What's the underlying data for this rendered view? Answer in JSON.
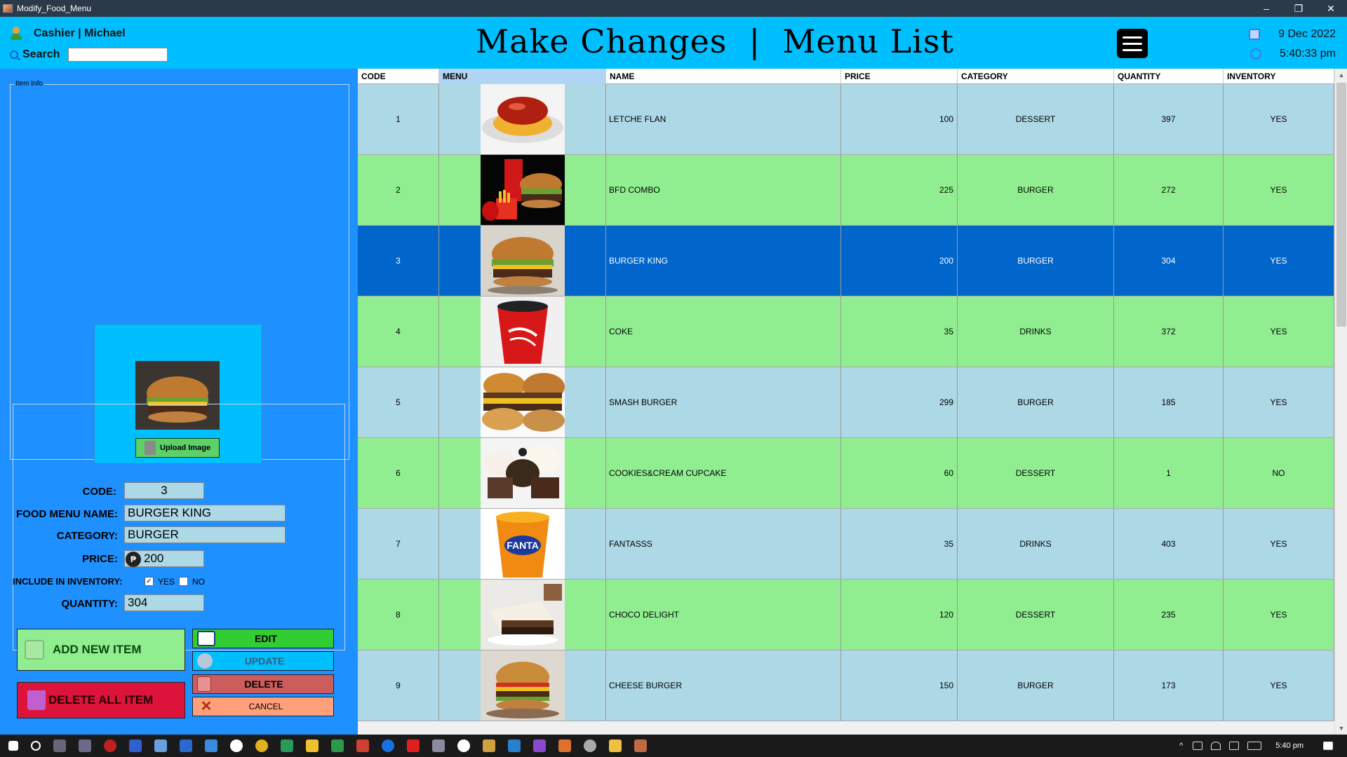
{
  "window": {
    "title": "Modify_Food_Menu",
    "controls": [
      "–",
      "❐",
      "✕"
    ]
  },
  "header": {
    "user": "Cashier | Michael",
    "search_label": "Search",
    "search_value": "",
    "title": "Make Changes  |  Menu List",
    "date": "9 Dec 2022",
    "time": "5:40:33 pm"
  },
  "item_info": {
    "group_label": "Item Info",
    "upload_label": "Upload Image",
    "labels": {
      "code": "CODE:",
      "name": "FOOD MENU NAME:",
      "category": "CATEGORY:",
      "price": "PRICE:",
      "inventory": "INCLUDE IN INVENTORY:",
      "quantity": "QUANTITY:",
      "yes": "YES",
      "no": "NO",
      "peso": "₱"
    },
    "values": {
      "code": "3",
      "name": "BURGER KING",
      "category": "BURGER",
      "price": "200",
      "quantity": "304",
      "inventory_yes_checked": true,
      "inventory_no_checked": false
    }
  },
  "buttons": {
    "add": "ADD NEW ITEM",
    "delete_all": "DELETE ALL ITEM",
    "edit": "EDIT",
    "update": "UPDATE",
    "delete": "DELETE",
    "cancel": "CANCEL"
  },
  "table": {
    "columns": [
      "CODE",
      "MENU",
      "NAME",
      "PRICE",
      "CATEGORY",
      "QUANTITY",
      "INVENTORY"
    ],
    "selected_code": "3",
    "rows": [
      {
        "code": "1",
        "name": "LETCHE FLAN",
        "price": "100",
        "category": "DESSERT",
        "quantity": "397",
        "inventory": "YES",
        "image": "flan-image"
      },
      {
        "code": "2",
        "name": "BFD COMBO",
        "price": "225",
        "category": "BURGER",
        "quantity": "272",
        "inventory": "YES",
        "image": "combo-image"
      },
      {
        "code": "3",
        "name": "BURGER KING",
        "price": "200",
        "category": "BURGER",
        "quantity": "304",
        "inventory": "YES",
        "image": "burger-image"
      },
      {
        "code": "4",
        "name": "COKE",
        "price": "35",
        "category": "DRINKS",
        "quantity": "372",
        "inventory": "YES",
        "image": "coke-image"
      },
      {
        "code": "5",
        "name": "SMASH BURGER",
        "price": "299",
        "category": "BURGER",
        "quantity": "185",
        "inventory": "YES",
        "image": "smash-burger-image"
      },
      {
        "code": "6",
        "name": "COOKIES&CREAM CUPCAKE",
        "price": "60",
        "category": "DESSERT",
        "quantity": "1",
        "inventory": "NO",
        "image": "cupcake-image"
      },
      {
        "code": "7",
        "name": "FANTASSS",
        "price": "35",
        "category": "DRINKS",
        "quantity": "403",
        "inventory": "YES",
        "image": "fanta-image"
      },
      {
        "code": "8",
        "name": "CHOCO DELIGHT",
        "price": "120",
        "category": "DESSERT",
        "quantity": "235",
        "inventory": "YES",
        "image": "cake-image"
      },
      {
        "code": "9",
        "name": "CHEESE BURGER",
        "price": "150",
        "category": "BURGER",
        "quantity": "173",
        "inventory": "YES",
        "image": "cheese-burger-image"
      }
    ]
  },
  "taskbar": {
    "time": "5:40 pm"
  },
  "colors": {
    "header": "#00bfff",
    "panel": "#1e90ff",
    "row_blue": "#add8e6",
    "row_green": "#90ee90",
    "row_selected": "#0066cc"
  }
}
